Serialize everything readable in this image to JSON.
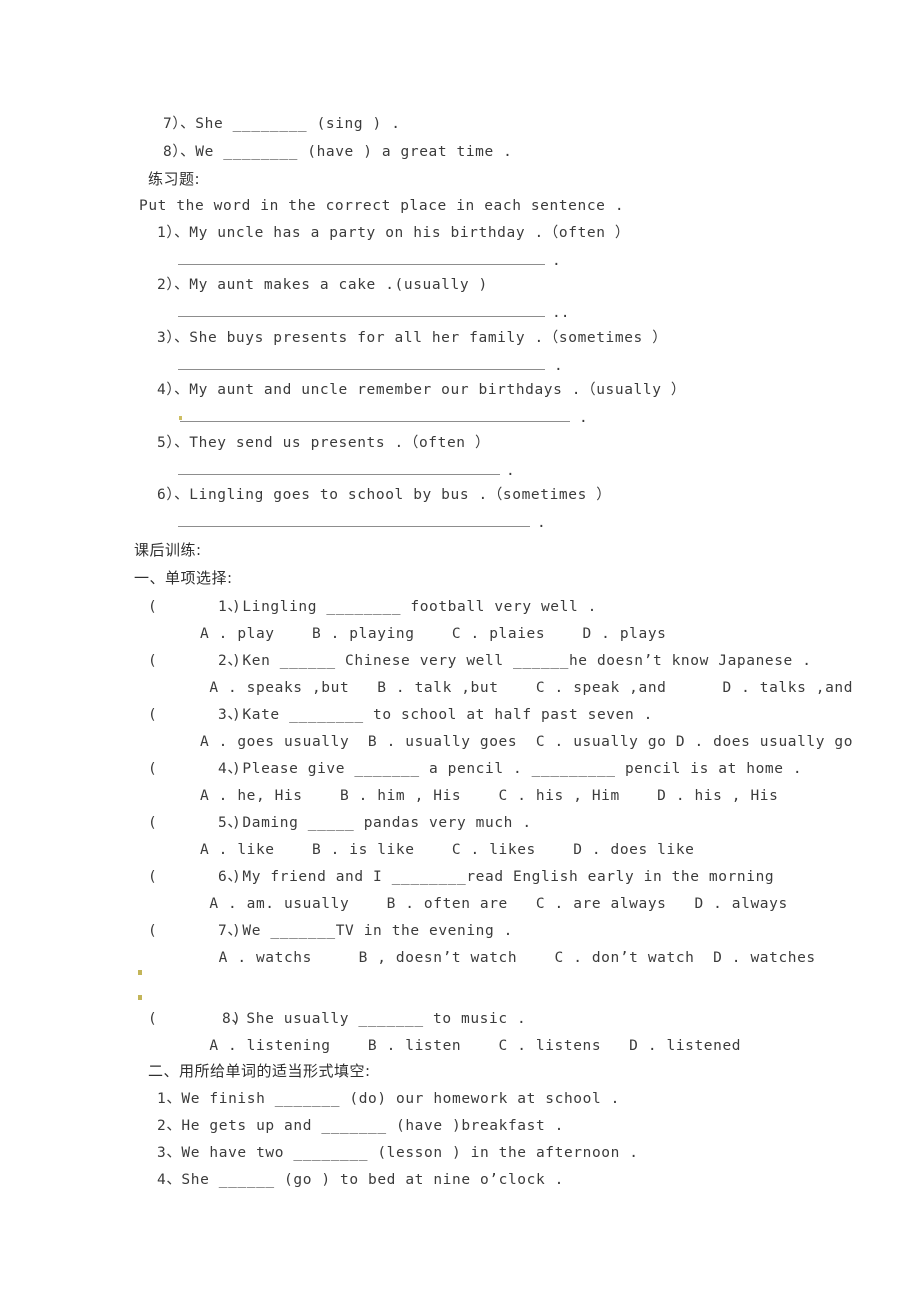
{
  "document": {
    "type": "worksheet-scan",
    "text_color": "#3b3b3b",
    "rule_color": "#8d8d8d",
    "speck_color": "#b8a83c"
  },
  "verb_form_items": {
    "item7": "7）、She ________ (sing ) .",
    "item8": "8）、We ________ (have ) a great time ."
  },
  "practice": {
    "heading": "练习题:",
    "instruction": "Put the word in the correct place in each sentence .",
    "items": [
      {
        "number": "1",
        "text": "1）、My uncle has a party on his birthday .（often ）",
        "answer_dot": "."
      },
      {
        "number": "2",
        "text": "2）、My aunt makes a cake .(usually )",
        "answer_dot": ".."
      },
      {
        "number": "3",
        "text": "3）、She buys presents for all her family .（sometimes ）",
        "answer_dot": "."
      },
      {
        "number": "4",
        "text": "4）、My aunt and uncle remember our birthdays .（usually ）",
        "answer_dot": "."
      },
      {
        "number": "5",
        "text": "5）、They send us presents .（often ）",
        "answer_dot": "."
      },
      {
        "number": "6",
        "text": "6）、Lingling goes to school by bus .（sometimes ）",
        "answer_dot": "."
      }
    ]
  },
  "after_class": {
    "heading": "课后训练:",
    "section_one_heading": "一、单项选择:",
    "section_two_heading": "二、用所给单词的适当形式填空:",
    "multiple_choice": [
      {
        "bracket": "(        )",
        "stem": "1、Lingling ________ football very well .",
        "options": "A . play    B . playing    C . plaies    D . plays"
      },
      {
        "bracket": "(        )",
        "stem": "2、Ken ______ Chinese very well ______he doesn’t know Japanese .",
        "options": " A . speaks ,but   B . talk ,but    C . speak ,and      D . talks ,and"
      },
      {
        "bracket": "(        )",
        "stem": "3、Kate ________ to school at half past seven .",
        "options": "A . goes usually  B . usually goes  C . usually go D . does usually go"
      },
      {
        "bracket": "(        )",
        "stem": "4、Please give _______ a pencil . _________ pencil is at home .",
        "options": "A . he, His    B . him , His    C . his , Him    D . his , His"
      },
      {
        "bracket": "(        )",
        "stem": "5、Daming _____ pandas very much .",
        "options": "A . like    B . is like    C . likes    D . does like"
      },
      {
        "bracket": "(        )",
        "stem": "6、My friend and I ________read English early in the morning",
        "options": " A . am. usually    B . often are   C . are always   D . always"
      },
      {
        "bracket": "(        )",
        "stem": "7、We _______TV in the evening .",
        "options": "  A . watchs     B , doesn’t watch    C . don’t watch  D . watches"
      },
      {
        "bracket": "(        )",
        "stem": "8、She usually _______ to music .",
        "options": " A . listening    B . listen    C . listens   D . listened"
      }
    ],
    "fill_in_blanks": [
      "1、We finish _______ (do) our homework at school .",
      "2、He gets up and _______ (have )breakfast .",
      "3、We have two ________ (lesson ) in the afternoon .",
      "4、She ______ (go ) to bed at nine o’clock ."
    ]
  }
}
